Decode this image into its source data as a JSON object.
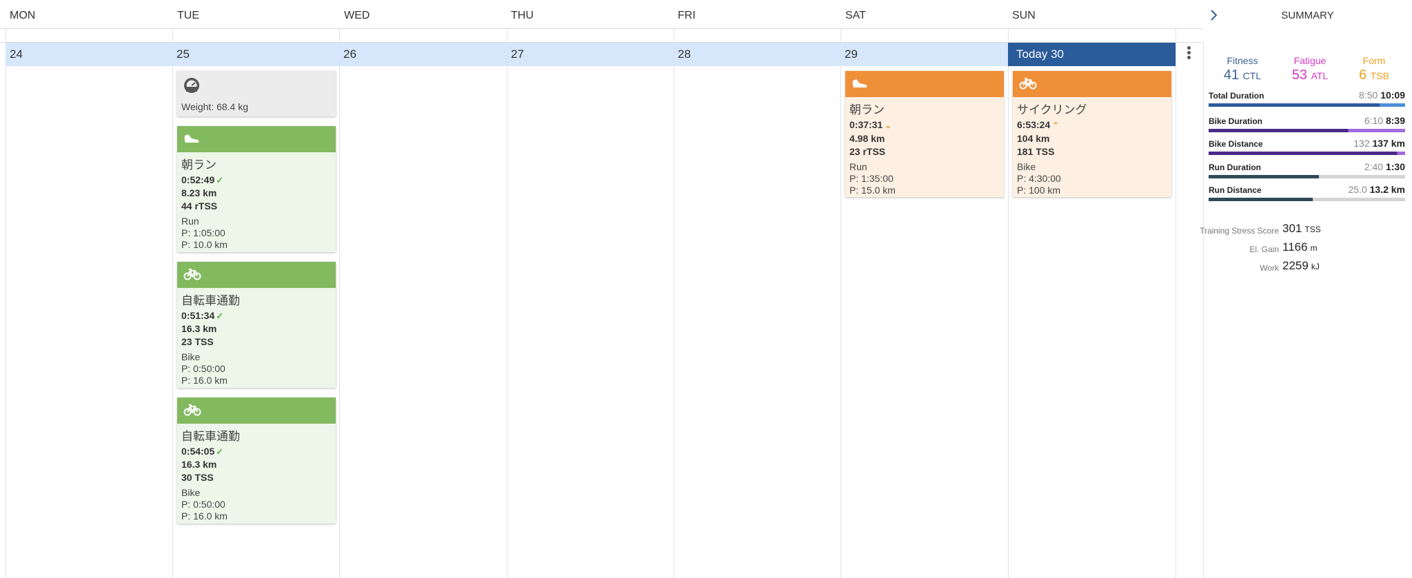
{
  "days": {
    "headers": [
      "MON",
      "TUE",
      "WED",
      "THU",
      "FRI",
      "SAT",
      "SUN"
    ],
    "dates": [
      "24",
      "25",
      "26",
      "27",
      "28",
      "29"
    ],
    "today_label": "Today 30"
  },
  "summary_title": "SUMMARY",
  "metric_card": {
    "icon": "scale-icon",
    "text": "Weight: 68.4 kg"
  },
  "workouts": {
    "tue_run": {
      "icon": "shoe-icon",
      "title": "朝ラン",
      "duration": "0:52:49",
      "distance": "8.23 km",
      "tss": "44 rTSS",
      "sport": "Run",
      "plan_time": "P: 1:05:00",
      "plan_dist": "P: 10.0 km"
    },
    "tue_bike1": {
      "icon": "bike-icon",
      "title": "自転車通勤",
      "duration": "0:51:34",
      "distance": "16.3 km",
      "tss": "23 TSS",
      "sport": "Bike",
      "plan_time": "P: 0:50:00",
      "plan_dist": "P: 16.0 km"
    },
    "tue_bike2": {
      "icon": "bike-icon",
      "title": "自転車通勤",
      "duration": "0:54:05",
      "distance": "16.3 km",
      "tss": "30 TSS",
      "sport": "Bike",
      "plan_time": "P: 0:50:00",
      "plan_dist": "P: 16.0 km"
    },
    "sat_run": {
      "icon": "shoe-icon",
      "title": "朝ラン",
      "duration": "0:37:31",
      "distance": "4.98 km",
      "tss": "23 rTSS",
      "sport": "Run",
      "plan_time": "P: 1:35:00",
      "plan_dist": "P: 15.0 km"
    },
    "sun_bike": {
      "icon": "bike-icon",
      "title": "サイクリング",
      "duration": "6:53:24",
      "distance": "104 km",
      "tss": "181 TSS",
      "sport": "Bike",
      "plan_time": "P: 4:30:00",
      "plan_dist": "P: 100 km"
    }
  },
  "fitness": {
    "fitness": {
      "label": "Fitness",
      "value": "41",
      "unit": "CTL",
      "color": "#3a5f96"
    },
    "fatigue": {
      "label": "Fatigue",
      "value": "53",
      "unit": "ATL",
      "color": "#d63ac6"
    },
    "form": {
      "label": "Form",
      "value": "6",
      "unit": "TSB",
      "color": "#f0a020"
    }
  },
  "bars": {
    "total_duration": {
      "label": "Total Duration",
      "planned": "8:50",
      "actual": "10:09",
      "fraction": 1.0,
      "planned_fraction": 0.87,
      "color": "#2a5b9a",
      "extra_color": "#4d8fd6"
    },
    "bike_duration": {
      "label": "Bike Duration",
      "planned": "6:10",
      "actual": "8:39",
      "fraction": 1.0,
      "planned_fraction": 0.71,
      "color": "#4b2a8a",
      "extra_color": "#a06ae0"
    },
    "bike_distance": {
      "label": "Bike Distance",
      "planned": "132",
      "actual": "137 km",
      "fraction": 1.0,
      "planned_fraction": 0.96,
      "color": "#4b2a8a",
      "extra_color": "#a06ae0"
    },
    "run_duration": {
      "label": "Run Duration",
      "planned": "2:40",
      "actual": "1:30",
      "fraction": 0.56,
      "color": "#2e4a57"
    },
    "run_distance": {
      "label": "Run Distance",
      "planned": "25.0",
      "actual": "13.2 km",
      "fraction": 0.53,
      "color": "#2e4a57"
    }
  },
  "stats": {
    "tss": {
      "label": "Training Stress Score",
      "value": "301",
      "unit": "TSS"
    },
    "elevation": {
      "label": "El. Gain",
      "value": "1166",
      "unit": "m"
    },
    "work": {
      "label": "Work",
      "value": "2259",
      "unit": "kJ"
    }
  }
}
